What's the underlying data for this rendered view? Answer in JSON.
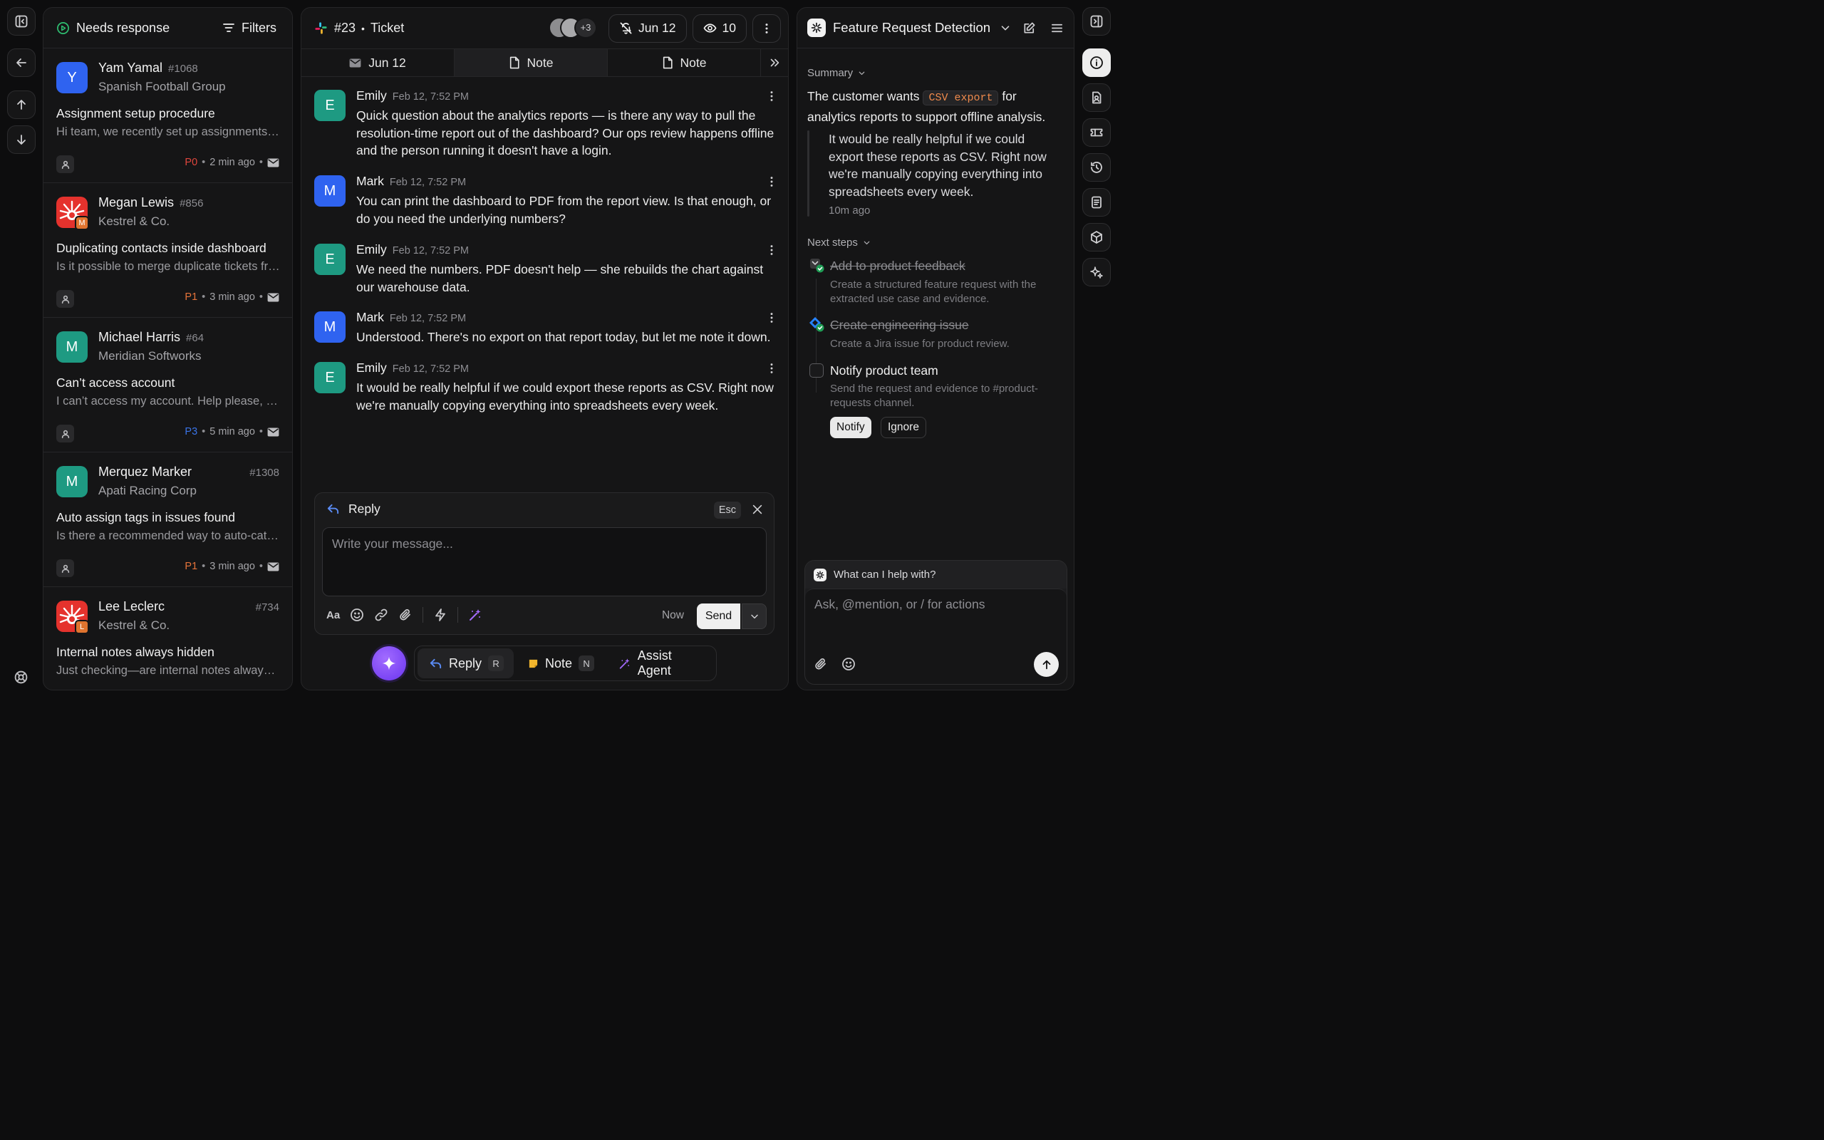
{
  "inbox": {
    "title": "Needs response",
    "filters_label": "Filters",
    "conversations": [
      {
        "name": "Yam Yamal",
        "num": "#1068",
        "avatar": "Y",
        "avatar_color": "#2f63f0",
        "company": "Spanish Football Group",
        "subject": "Assignment setup procedure",
        "preview": "Hi team, we recently set up assignments and wanted to confirm",
        "priority": "P0",
        "priority_color": "#e0463d",
        "time": "2 min ago"
      },
      {
        "name": "Megan Lewis",
        "num": "#856",
        "avatar": "M",
        "company": "Kestrel & Co.",
        "subject": "Duplicating contacts inside dashboard",
        "preview": "Is it possible to merge duplicate tickets from the same contact?",
        "priority": "P1",
        "priority_color": "#e5733a",
        "time": "3 min ago"
      },
      {
        "name": "Michael Harris",
        "num": "#64",
        "avatar": "M",
        "avatar_color": "#1e9a82",
        "company": "Meridian Softworks",
        "subject": "Can’t access account",
        "preview": "I can’t access my account. Help please, I tried resetting",
        "priority": "P3",
        "priority_color": "#3a74e8",
        "time": "5 min ago"
      },
      {
        "name": "Merquez Marker",
        "num": "#1308",
        "avatar": "M",
        "avatar_color": "#1e9a82",
        "company": "Apati Racing Corp",
        "subject": "Auto assign tags in issues found",
        "preview": "Is there a recommended way to auto-categorize incoming issues?",
        "priority": "P1",
        "priority_color": "#e5733a",
        "time": "3 min ago"
      },
      {
        "name": "Lee Leclerc",
        "num": "#734",
        "avatar": "L",
        "company": "Kestrel & Co.",
        "subject": "Internal notes always hidden",
        "preview": "Just checking—are internal notes always hidden from customers?"
      }
    ]
  },
  "ticket": {
    "number": "#23",
    "label": "Ticket",
    "participants_more": "+3",
    "snooze_date": "Jun 12",
    "watchers": "10",
    "tabs": [
      {
        "label": "Jun 12",
        "icon": "mail-icon"
      },
      {
        "label": "Note",
        "icon": "note-icon"
      },
      {
        "label": "Note",
        "icon": "note-icon"
      }
    ],
    "messages": [
      {
        "author": "Emily",
        "avatar": "E",
        "color": "#1e9a82",
        "time": "Feb 12, 7:52 PM",
        "text": "Quick question about the analytics reports — is there any way to pull the resolution-time report out of the dashboard? Our ops review happens offline and the person running it doesn't have a login."
      },
      {
        "author": "Mark",
        "avatar": "M",
        "color": "#2f63f0",
        "time": "Feb 12, 7:52 PM",
        "text": "You can print the dashboard to PDF from the report view. Is that enough, or do you need the underlying numbers?"
      },
      {
        "author": "Emily",
        "avatar": "E",
        "color": "#1e9a82",
        "time": "Feb 12, 7:52 PM",
        "text": "We need the numbers. PDF doesn't help — she rebuilds the chart against our warehouse data."
      },
      {
        "author": "Mark",
        "avatar": "M",
        "color": "#2f63f0",
        "time": "Feb 12, 7:52 PM",
        "text": "Understood. There's no export on that report today, but let me note it down."
      },
      {
        "author": "Emily",
        "avatar": "E",
        "color": "#1e9a82",
        "time": "Feb 12, 7:52 PM",
        "text": "It would be really helpful if we could export these reports as CSV. Right now we're manually copying everything into spreadsheets every week."
      }
    ]
  },
  "composer": {
    "mode": "Reply",
    "esc": "Esc",
    "placeholder": "Write your message...",
    "font_label": "Aa",
    "now": "Now",
    "send": "Send"
  },
  "bottom_bar": {
    "reply": "Reply",
    "reply_key": "R",
    "note": "Note",
    "note_key": "N",
    "assist": "Assist Agent"
  },
  "detection": {
    "title": "Feature Request Detection",
    "summary_label": "Summary",
    "summary_pre": "The customer wants",
    "summary_code": "CSV export",
    "summary_post_1": "for",
    "summary_post_2": "analytics reports to support offline analysis.",
    "quote": "It would be really helpful if we could export these reports as CSV. Right now we're manually copying everything into spreadsheets every week.",
    "quote_time": "10m ago",
    "next_steps_label": "Next steps",
    "steps": [
      {
        "title": "Add to product feedback",
        "desc": "Create a structured feature request with the extracted use case and evidence."
      },
      {
        "title": "Create engineering issue",
        "desc": "Create a Jira issue for product review."
      },
      {
        "title": "Notify product team",
        "desc": "Send the request and evidence to #product-requests channel."
      }
    ],
    "notify_btn": "Notify",
    "ignore_btn": "Ignore"
  },
  "assistant": {
    "prompt": "What can I help with?",
    "placeholder": "Ask, @mention, or / for actions"
  }
}
